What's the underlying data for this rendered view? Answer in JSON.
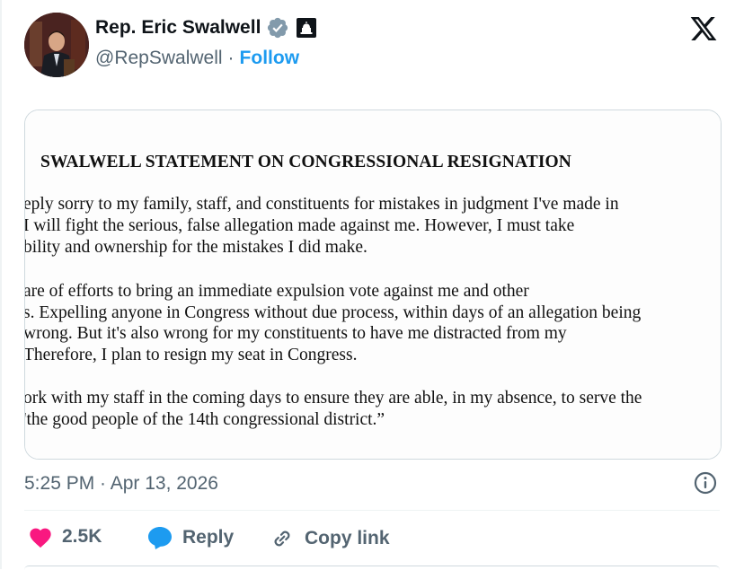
{
  "author": {
    "name": "Rep. Eric Swalwell",
    "handle": "@RepSwalwell",
    "separator": "·",
    "follow_label": "Follow"
  },
  "icons": {
    "verified": "verified-badge-icon",
    "government": "capitol-building-icon",
    "platform": "x-logo-icon",
    "like": "heart-icon",
    "reply": "speech-bubble-icon",
    "copy": "link-icon",
    "info": "info-icon"
  },
  "colors": {
    "accent": "#1d9bf0",
    "like": "#f91880",
    "verified": "#829aab",
    "text_secondary": "#536471"
  },
  "document": {
    "title": "SWALWELL STATEMENT ON CONGRESSIONAL RESIGNATION",
    "lines": [
      "eply sorry to my family, staff, and constituents for mistakes in judgment I've made in",
      " I will fight the serious, false allegation made against me. However, I must take",
      "bility and ownership for the mistakes I did make.",
      "are of efforts to bring an immediate expulsion vote against me and other",
      "s.  Expelling anyone in Congress without due process, within days of an allegation being",
      " wrong.  But it's also wrong for my constituents to have me distracted from my",
      "Therefore, I plan to resign my seat in Congress.",
      "ork with my staff in the coming days to ensure they are able, in my absence, to serve the",
      "'the good people of the 14th congressional district.”"
    ]
  },
  "timestamp": "5:25 PM · Apr 13, 2026",
  "actions": {
    "like_count": "2.5K",
    "reply_label": "Reply",
    "copy_label": "Copy link"
  }
}
